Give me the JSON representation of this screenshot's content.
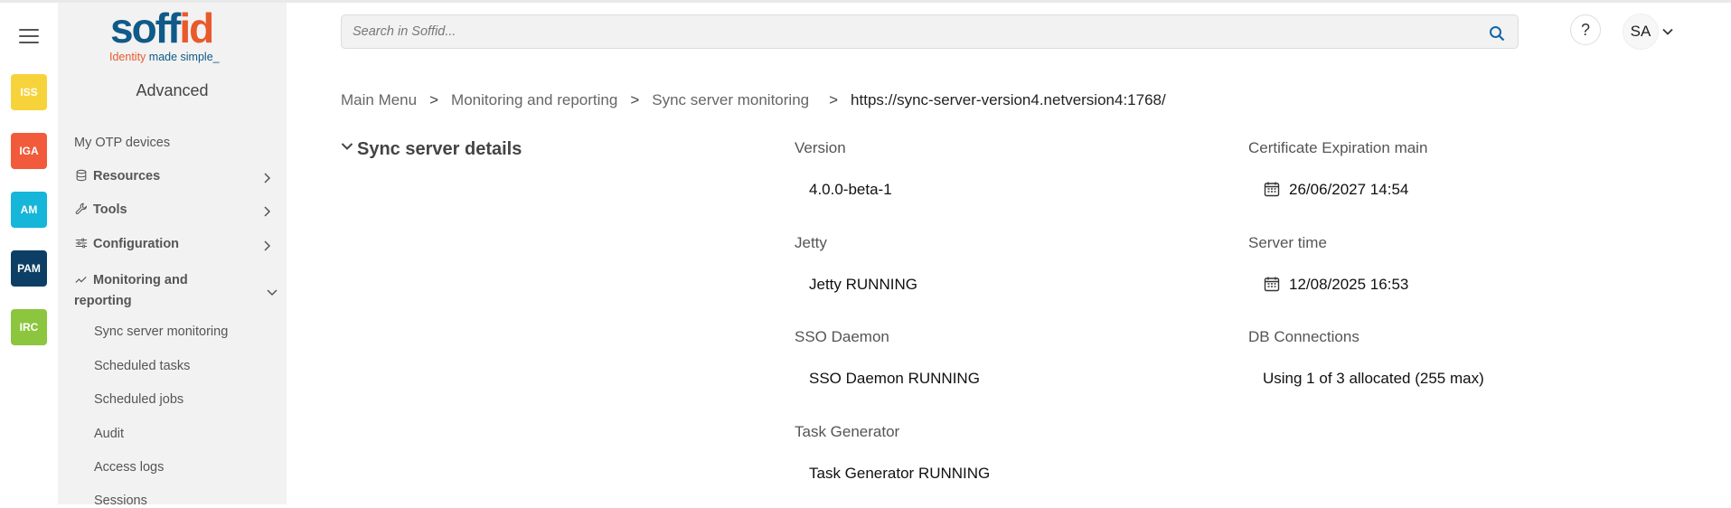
{
  "app": {
    "logo_text_primary": "soff",
    "logo_text_accent": "id",
    "tagline_part1": "Identity",
    "tagline_part2": " made simple_"
  },
  "rail": {
    "modules": [
      {
        "label": "ISS",
        "color": "#f7d33b"
      },
      {
        "label": "IGA",
        "color": "#f15a3a"
      },
      {
        "label": "AM",
        "color": "#15b6d9"
      },
      {
        "label": "PAM",
        "color": "#0d3f66"
      },
      {
        "label": "IRC",
        "color": "#8cc63f"
      }
    ]
  },
  "sidebar": {
    "title": "Advanced",
    "items": [
      {
        "label": "My OTP devices"
      },
      {
        "label": "Resources"
      },
      {
        "label": "Tools"
      },
      {
        "label": "Configuration"
      },
      {
        "label": "Monitoring and reporting"
      }
    ],
    "subitems": [
      {
        "label": "Sync server monitoring"
      },
      {
        "label": "Scheduled tasks"
      },
      {
        "label": "Scheduled jobs"
      },
      {
        "label": "Audit"
      },
      {
        "label": "Access logs"
      },
      {
        "label": "Sessions"
      }
    ]
  },
  "header": {
    "search_placeholder": "Search in Soffid...",
    "help_label": "?",
    "avatar_initials": "SA"
  },
  "breadcrumb": {
    "items": [
      "Main Menu",
      "Monitoring and reporting",
      "Sync server monitoring"
    ],
    "separator": ">",
    "current": "https://sync-server-version4.netversion4:1768/"
  },
  "details": {
    "section_title": "Sync server details",
    "fields": {
      "version": {
        "label": "Version",
        "value": "4.0.0-beta-1"
      },
      "jetty": {
        "label": "Jetty",
        "value": "Jetty RUNNING"
      },
      "sso": {
        "label": "SSO Daemon",
        "value": "SSO Daemon RUNNING"
      },
      "task_generator": {
        "label": "Task Generator",
        "value": "Task Generator RUNNING"
      },
      "cert_expiration": {
        "label": "Certificate Expiration main",
        "value": "26/06/2027 14:54"
      },
      "server_time": {
        "label": "Server time",
        "value": "12/08/2025 16:53"
      },
      "db_connections": {
        "label": "DB Connections",
        "value": "Using 1 of 3 allocated (255 max)"
      }
    }
  }
}
